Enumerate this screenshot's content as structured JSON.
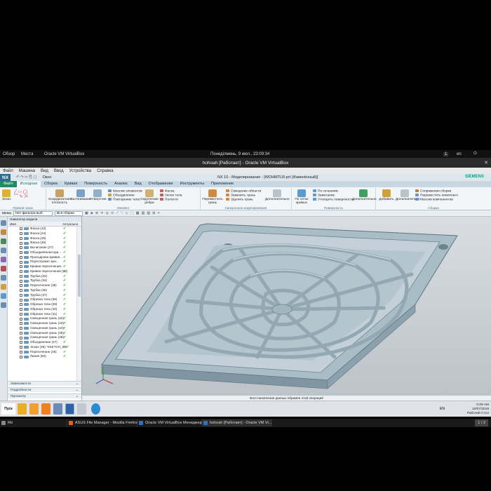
{
  "host_panel": {
    "overview": "Обзор",
    "places": "Места",
    "app": "Oracle VM VirtualBox",
    "clock": "Понеділмень, 9 июл., 23:09:34",
    "badge": "1",
    "lang": "en"
  },
  "vbox": {
    "title": "hohoah [Работает] - Oracle VM VirtualBox",
    "menu": [
      "Файл",
      "Машина",
      "Вид",
      "Ввод",
      "Устройства",
      "Справка"
    ]
  },
  "nx": {
    "logo": "NX",
    "title": "NX 10 - Моделирование - [WOHMTLR.prt (Изменённый)]",
    "brand": "SIEMENS",
    "window_menu": "Окно",
    "tabs": [
      "Файл",
      "Исходная",
      "Сборка",
      "Кривая",
      "Поверхность",
      "Анализ",
      "Вид",
      "Отображение",
      "Инструменты",
      "Приложение"
    ],
    "ribbon": {
      "g1_big": [
        "Эскиз",
        "Эскиз"
      ],
      "g1_title": "Прямой эскиз",
      "g2_big": [
        "Координатная плоскость",
        "Вытягивание",
        "Отверстие"
      ],
      "g2_small": [
        "Массив элементов",
        "Объединение",
        "Повторение тела"
      ],
      "g3_big": [
        "Скругление ребра"
      ],
      "g3_small": [
        "Фаска",
        "Уклон тела",
        "Полости"
      ],
      "g23_title": "Элемент",
      "g4_big": [
        "Переместить грань"
      ],
      "g4_small": [
        "Смещение области",
        "Заменить грань",
        "Удалить грань"
      ],
      "g4_title": "Синхронное моделирование",
      "g5_big": [
        "По сетке кривых"
      ],
      "g5_small": [
        "По сечениям",
        "Заметание",
        "Утолщить поверхность"
      ],
      "g5_title": "Поверхность",
      "more": "Дополнительно",
      "g6_big": [
        "Добавить"
      ],
      "g6_small": [
        "Сопряжения сборки",
        "Переместить компонент",
        "Массив компонентов"
      ],
      "g6_title": "Сборка"
    },
    "toolbar2": {
      "menu": "Меню",
      "filter": "Нет фильтра выб.",
      "assembly": "Вся сборка"
    },
    "navigator": {
      "title": "Навигатор модели",
      "col_name": "Имя",
      "col_current": "Актуально",
      "items": [
        "Фаска (23)",
        "Фаска (24)",
        "Фаска (25)",
        "Фаска (26)",
        "Вычитание (27)",
        "Объединённая кри...",
        "Проецирова кривая...",
        "Переотражат кри...",
        "Кривая пересечения...",
        "Кривая пересечения (32)",
        "Трубка (33)",
        "Трубка (34)",
        "Пересечение (35)",
        "Трубка (36)",
        "Трубка (37)",
        "Обрезка тела (38)",
        "Обрезка тела (39)",
        "Обрезка тела (40)",
        "Обрезка тела (41)",
        "Смещенная грань (42)",
        "Смещенная грань (43)",
        "Смещенная грань (44)",
        "Смещенная грань (45)",
        "Смещенная грань (46)",
        "Объединение (47)",
        "Эскиз (48) \"SKETCH_002\"",
        "Пересечение (49)",
        "Линия (50)"
      ],
      "current_mark": "✔",
      "panels": [
        "Зависимости",
        "Подробности",
        "Просмотр"
      ]
    },
    "status": "Восстановление данных обрамен этой операций"
  },
  "win_taskbar": {
    "start": "Пуск",
    "lang": "EN",
    "time": "0:09 AM",
    "date": "10/07/2018",
    "desktop": "Рабочий Стол"
  },
  "host_taskbar": {
    "items": [
      "Rtr",
      "ASUS File Manager - Mozilla Firefox",
      "Oracle VM VirtualBox Менеджер",
      "hohoah [Работает] - Oracle VM Vi..."
    ],
    "pager": "1 / 2"
  },
  "colors": {
    "file_tab": "#1f8a64",
    "model": "#9db3be",
    "ok": "#22a022"
  }
}
